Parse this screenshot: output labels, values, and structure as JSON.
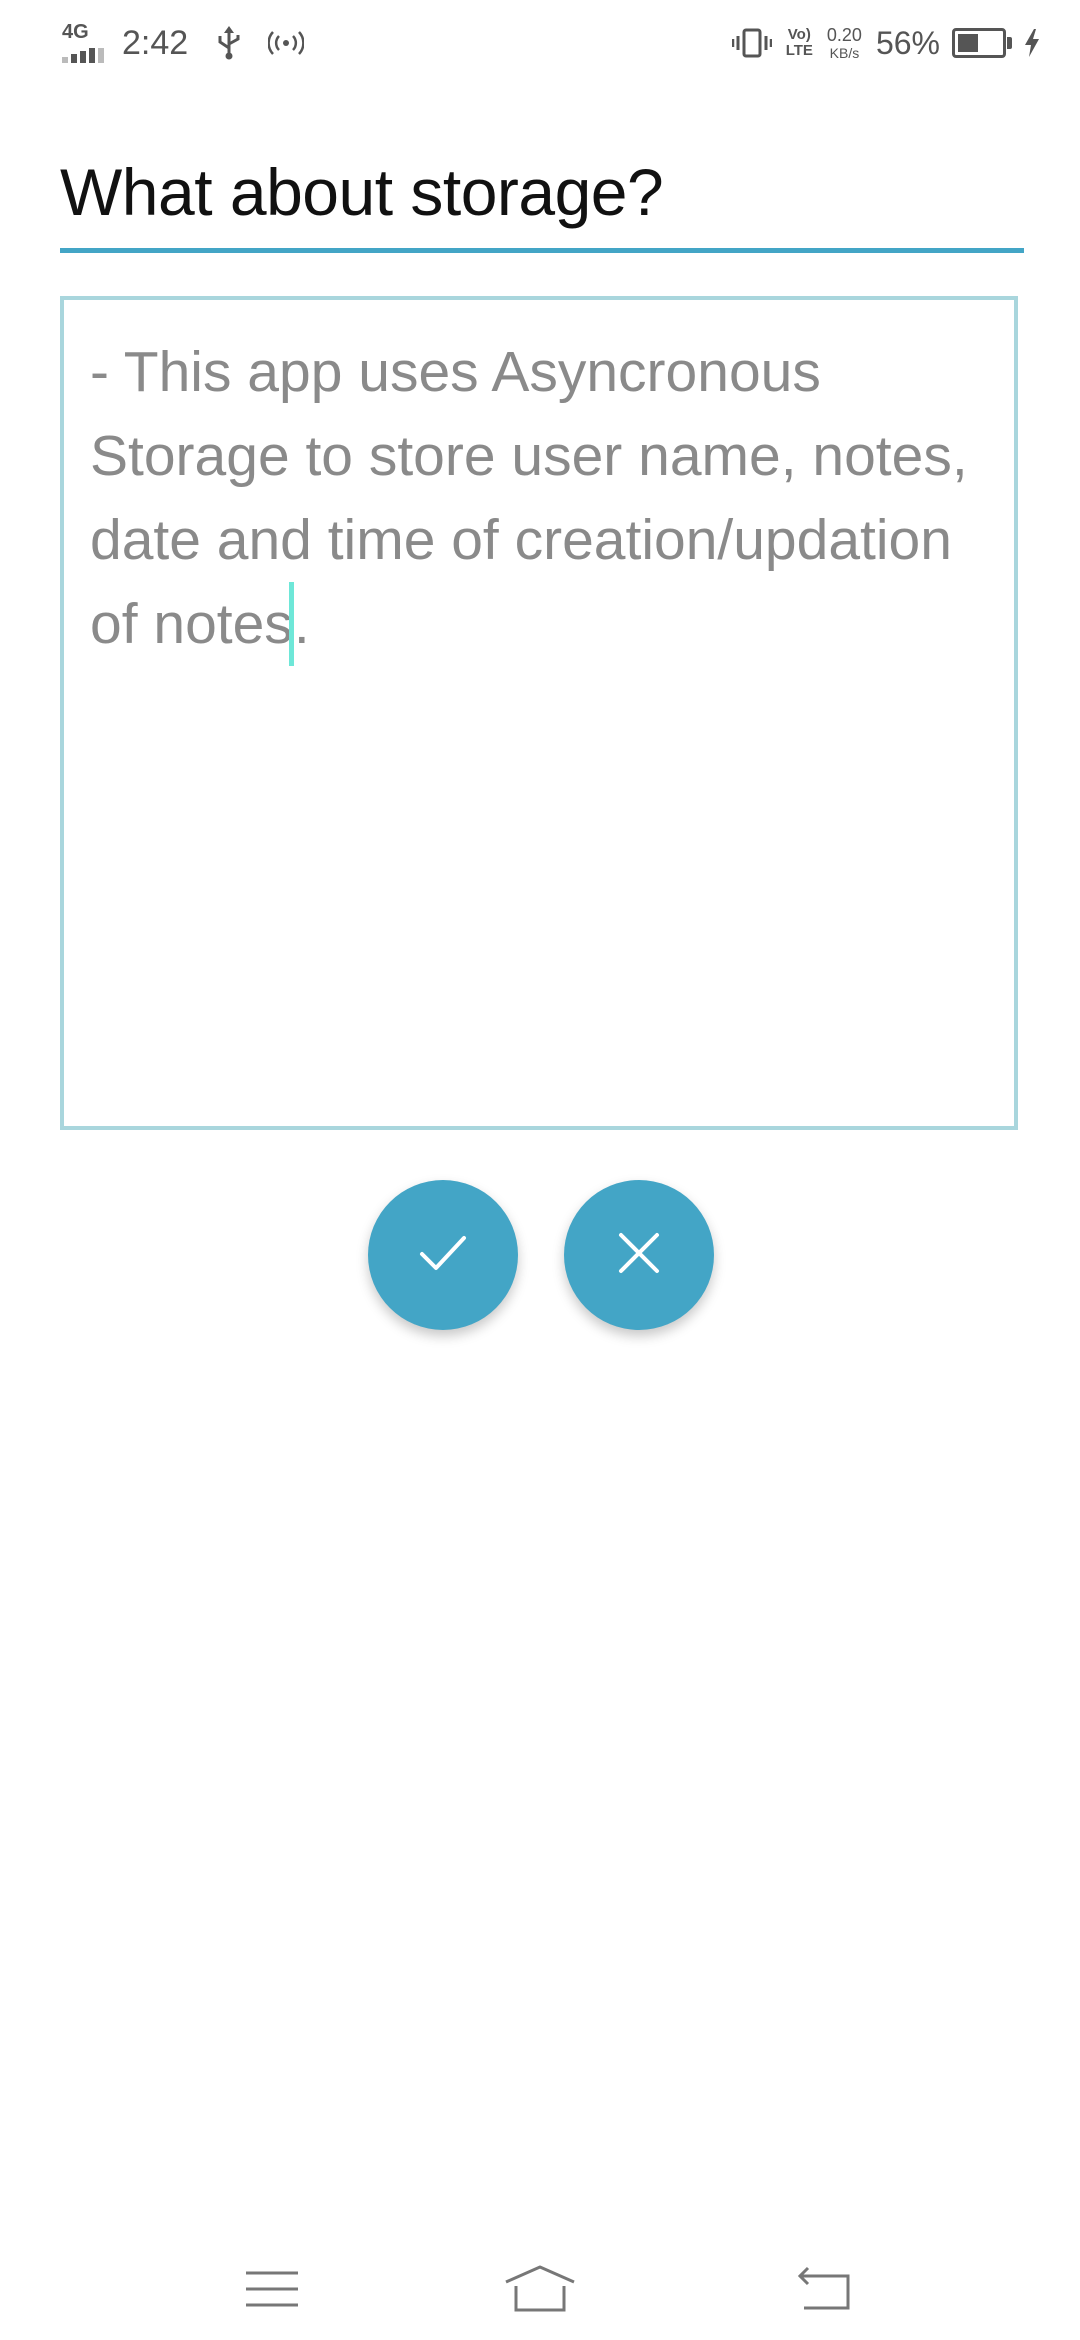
{
  "status_bar": {
    "network": "4G",
    "time": "2:42",
    "volte_top": "Vo)",
    "volte_bottom": "LTE",
    "net_speed_value": "0.20",
    "net_speed_unit": "KB/s",
    "battery_percent": "56%",
    "battery_level": 0.56,
    "icons": [
      "signal-icon",
      "usb-icon",
      "hotspot-icon",
      "vibrate-icon",
      "battery-icon",
      "charging-icon"
    ]
  },
  "note": {
    "title": "What about storage?",
    "body": "- This app uses Asyncronous Storage to store user name, notes, date and time of creation/updation of notes."
  },
  "actions": {
    "confirm_icon": "check-icon",
    "cancel_icon": "close-icon"
  },
  "nav_bar": {
    "icons": [
      "menu-icon",
      "home-icon",
      "back-icon"
    ]
  },
  "colors": {
    "accent": "#43a5c6",
    "textarea_border": "#a9d6dd",
    "body_text": "#8a8a8a",
    "cursor": "#6ee7d8"
  }
}
